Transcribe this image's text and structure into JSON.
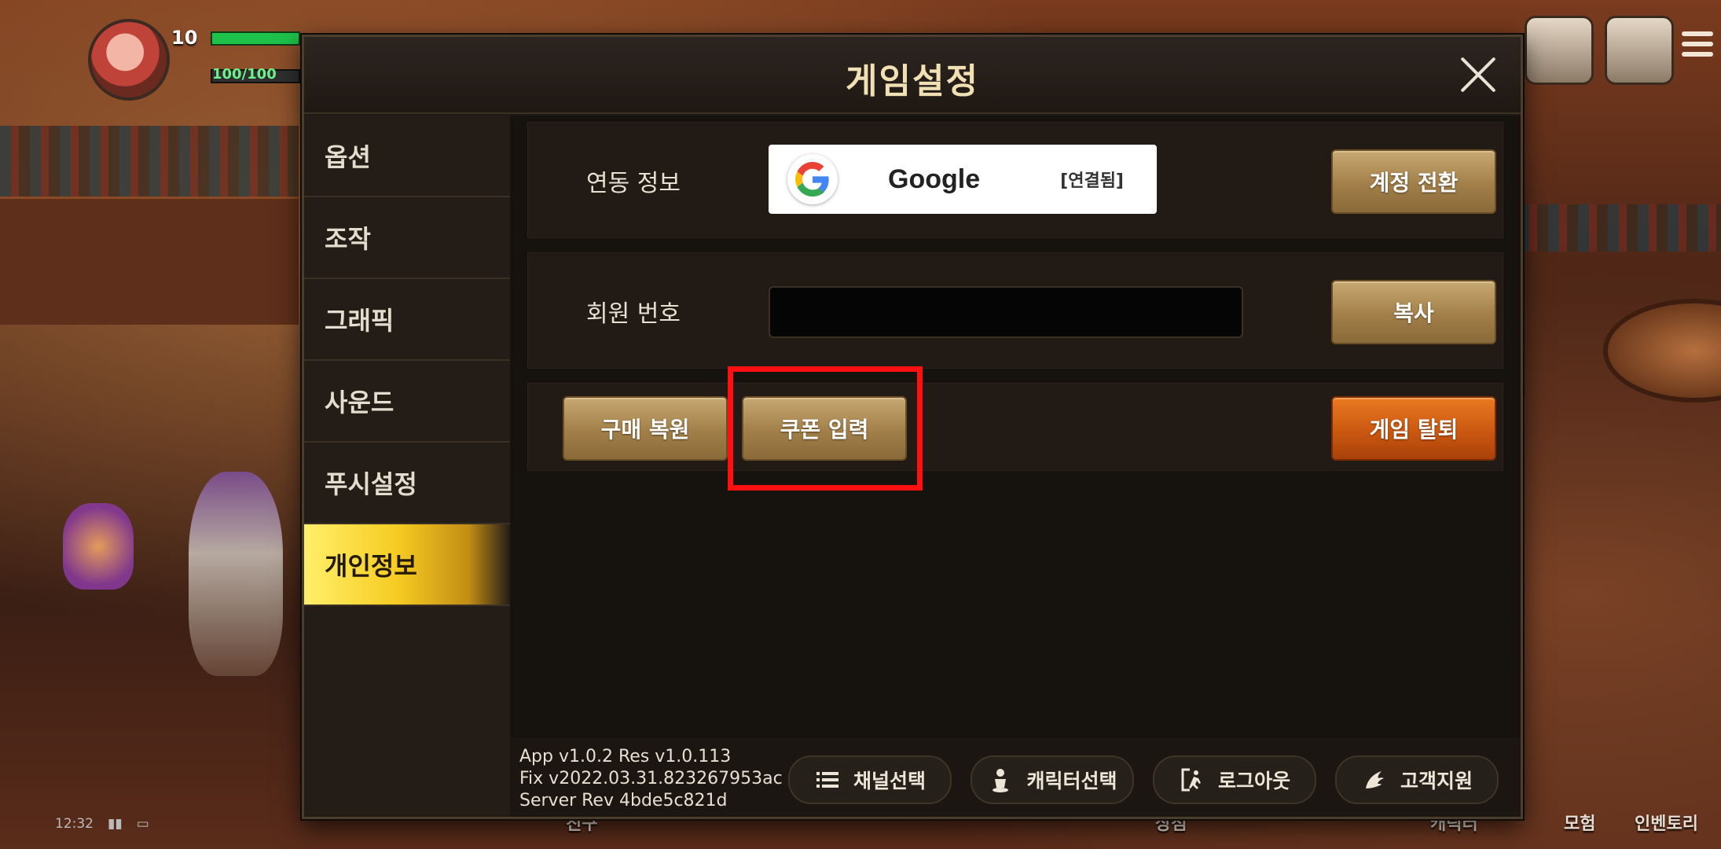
{
  "dialog": {
    "title": "게임설정",
    "close_label": "×"
  },
  "sidebar": {
    "items": [
      {
        "label": "옵션",
        "active": false
      },
      {
        "label": "조작",
        "active": false
      },
      {
        "label": "그래픽",
        "active": false
      },
      {
        "label": "사운드",
        "active": false
      },
      {
        "label": "푸시설정",
        "active": false
      },
      {
        "label": "개인정보",
        "active": true
      }
    ]
  },
  "account": {
    "link_label": "연동 정보",
    "provider": "Google",
    "link_status": "[연결됨]",
    "switch_button": "계정 전환",
    "member_label": "회원 번호",
    "member_value": "",
    "copy_button": "복사"
  },
  "actions": {
    "restore_purchase": "구매 복원",
    "coupon_input": "쿠폰 입력",
    "withdraw": "게임 탈퇴"
  },
  "footer": {
    "version_lines": [
      "App v1.0.2 Res v1.0.113",
      "Fix v2022.03.31.823267953ac",
      "Server Rev 4bde5c821d"
    ],
    "buttons": [
      {
        "label": "채널선택",
        "icon": "list-icon"
      },
      {
        "label": "캐릭터선택",
        "icon": "character-icon"
      },
      {
        "label": "로그아웃",
        "icon": "logout-icon"
      },
      {
        "label": "고객지원",
        "icon": "support-icon"
      }
    ]
  },
  "hud": {
    "level": "10",
    "mp_text": "100/100",
    "status_time": "12:32",
    "bottom_nav": [
      "친구",
      "상점",
      "캐릭터",
      "모험",
      "인벤토리"
    ]
  },
  "colors": {
    "accent_gold": "#f7cc22",
    "button_tan": "#a27f48",
    "danger_orange": "#c85510",
    "highlight_red": "#ff1010"
  }
}
